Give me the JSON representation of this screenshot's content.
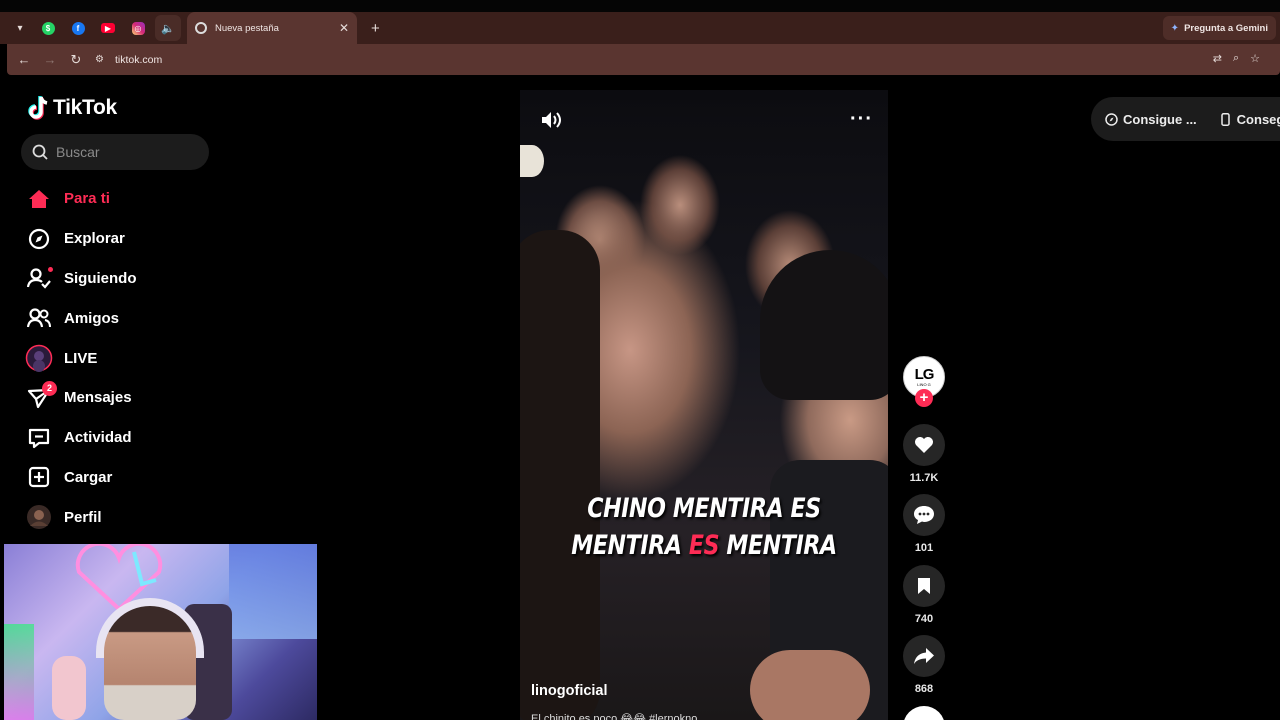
{
  "browser": {
    "pinned_tabs": [
      {
        "name": "whatsapp",
        "color": "#25d366",
        "glyph": "●"
      },
      {
        "name": "facebook",
        "color": "#1877f2",
        "glyph": "f"
      },
      {
        "name": "youtube",
        "color": "#ff0033",
        "glyph": "▶"
      },
      {
        "name": "instagram",
        "color": "#e1306c",
        "glyph": "◎"
      }
    ],
    "active_tab_title": "Nueva pestaña",
    "gemini_label": "Pregunta a Gemini",
    "url": "tiktok.com"
  },
  "sidebar": {
    "logo_text": "TikTok",
    "search_placeholder": "Buscar",
    "items": [
      {
        "label": "Para ti",
        "icon": "home-icon",
        "active": true
      },
      {
        "label": "Explorar",
        "icon": "compass-icon"
      },
      {
        "label": "Siguiendo",
        "icon": "following-icon",
        "dot": true
      },
      {
        "label": "Amigos",
        "icon": "friends-icon"
      },
      {
        "label": "LIVE",
        "icon": "live-icon"
      },
      {
        "label": "Mensajes",
        "icon": "messages-icon",
        "badge": "2"
      },
      {
        "label": "Actividad",
        "icon": "activity-icon"
      },
      {
        "label": "Cargar",
        "icon": "upload-icon"
      },
      {
        "label": "Perfil",
        "icon": "profile-avatar"
      }
    ]
  },
  "video": {
    "caption_line1": "CHINO MENTIRA ES",
    "caption_line2_a": "MENTIRA",
    "caption_line2_b": "ES",
    "caption_line2_c": "MENTIRA",
    "author": "linogoficial",
    "description": "El chinito es poco 😂😂 #lernokno..."
  },
  "actions": {
    "avatar_initials": "LG",
    "avatar_sub": "LINO G",
    "likes": "11.7K",
    "comments": "101",
    "saves": "740",
    "shares": "868"
  },
  "top_right": {
    "item1": "Consigue ...",
    "item2": "Consegu"
  },
  "colors": {
    "accent": "#fe2c55",
    "tabbar": "#3a1f1b",
    "addressbar": "#5a3530"
  }
}
